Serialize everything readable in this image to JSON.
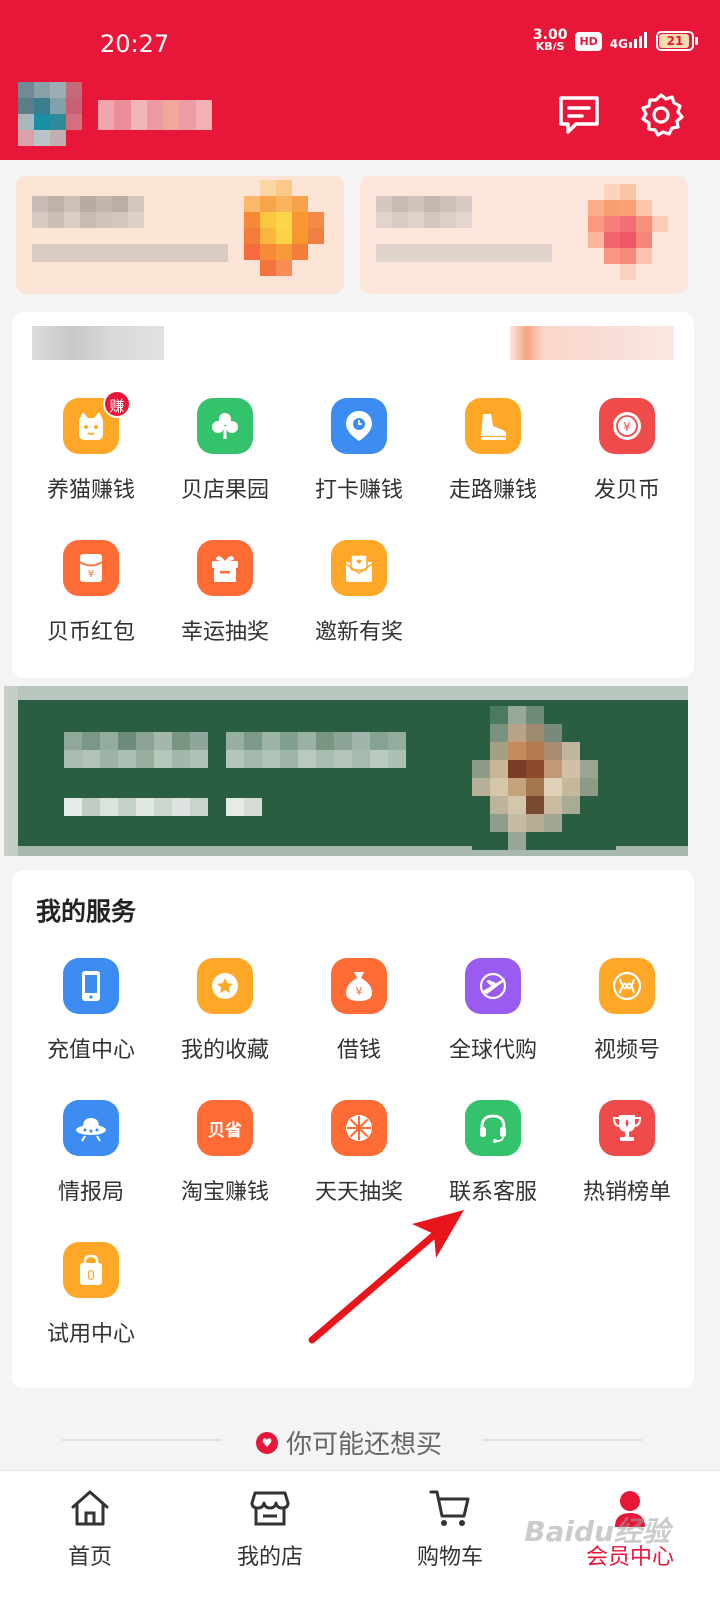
{
  "status_bar": {
    "time": "20:27",
    "net_speed": "3.00",
    "net_unit": "KB/S",
    "hd": "HD",
    "signal": "4G",
    "battery": "21"
  },
  "header": {
    "messages_icon": "message-icon",
    "settings_icon": "gear-icon"
  },
  "tasks": {
    "items": [
      {
        "label": "养猫赚钱",
        "icon": "cat-icon",
        "color": "#ffa726",
        "badge": "赚"
      },
      {
        "label": "贝店果园",
        "icon": "clover-icon",
        "color": "#34c26a"
      },
      {
        "label": "打卡赚钱",
        "icon": "location-pin-icon",
        "color": "#3c8cf2"
      },
      {
        "label": "走路赚钱",
        "icon": "shoe-icon",
        "color": "#ffa726"
      },
      {
        "label": "发贝币",
        "icon": "coin-icon",
        "color": "#ef4b4b"
      },
      {
        "label": "贝币红包",
        "icon": "red-envelope-icon",
        "color": "#ff6b35"
      },
      {
        "label": "幸运抽奖",
        "icon": "gift-box-icon",
        "color": "#ff6b35"
      },
      {
        "label": "邀新有奖",
        "icon": "invite-envelope-icon",
        "color": "#ffa726"
      }
    ]
  },
  "services": {
    "title": "我的服务",
    "items": [
      {
        "label": "充值中心",
        "icon": "phone-recharge-icon",
        "color": "#3c8cf2"
      },
      {
        "label": "我的收藏",
        "icon": "star-icon",
        "color": "#ffa726"
      },
      {
        "label": "借钱",
        "icon": "money-bag-icon",
        "color": "#ff6b35"
      },
      {
        "label": "全球代购",
        "icon": "plane-icon",
        "color": "#9a5cf0"
      },
      {
        "label": "视频号",
        "icon": "video-channel-icon",
        "color": "#ffa726"
      },
      {
        "label": "情报局",
        "icon": "ufo-icon",
        "color": "#3c8cf2"
      },
      {
        "label": "淘宝赚钱",
        "icon": "taobao-icon",
        "color": "#ff6b35",
        "text": "贝省"
      },
      {
        "label": "天天抽奖",
        "icon": "lottery-wheel-icon",
        "color": "#ff6b35"
      },
      {
        "label": "联系客服",
        "icon": "headset-icon",
        "color": "#34c26a"
      },
      {
        "label": "热销榜单",
        "icon": "trophy-icon",
        "color": "#ef4b4b"
      },
      {
        "label": "试用中心",
        "icon": "shopping-bag-icon",
        "color": "#ffa726",
        "text": "0"
      }
    ]
  },
  "recommend": {
    "label": "你可能还想买"
  },
  "bottom_nav": {
    "items": [
      {
        "label": "首页",
        "icon": "home-icon"
      },
      {
        "label": "我的店",
        "icon": "store-icon"
      },
      {
        "label": "购物车",
        "icon": "cart-icon"
      },
      {
        "label": "会员中心",
        "icon": "member-icon",
        "active": true
      }
    ]
  },
  "watermark": "Baidu经验",
  "colors": {
    "brand": "#e8173a",
    "annotation_arrow": "#e8151b"
  }
}
